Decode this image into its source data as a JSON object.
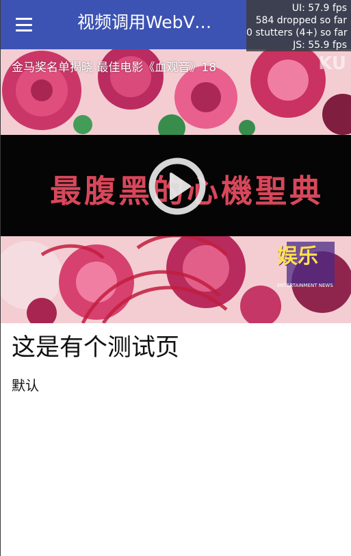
{
  "toolbar": {
    "menu_icon": "hamburger-menu-icon",
    "title": "视频调用WebView"
  },
  "perf_monitor": {
    "ui_fps": "UI: 57.9 fps",
    "dropped": "584 dropped so far",
    "stutters": "0 stutters (4+) so far",
    "js_fps": "JS: 55.9 fps"
  },
  "video": {
    "caption": "金马奖名单揭晓 最佳电影《血观音》18",
    "banner_text": "最腹黑的心機聖典",
    "watermark": "KU",
    "logo_main": "娱乐",
    "logo_sub": "ENTERTAINMENT NEWS",
    "play_icon": "play-circle-icon",
    "colors": {
      "banner": "#050505",
      "banner_text": "#d8475a",
      "background": "#f2c6cc"
    }
  },
  "content": {
    "heading": "这是有个测试页",
    "body": "默认"
  },
  "colors": {
    "toolbar": "#3d53b3",
    "toolbar_text": "#ffffff",
    "page_background": "#ffffff"
  }
}
